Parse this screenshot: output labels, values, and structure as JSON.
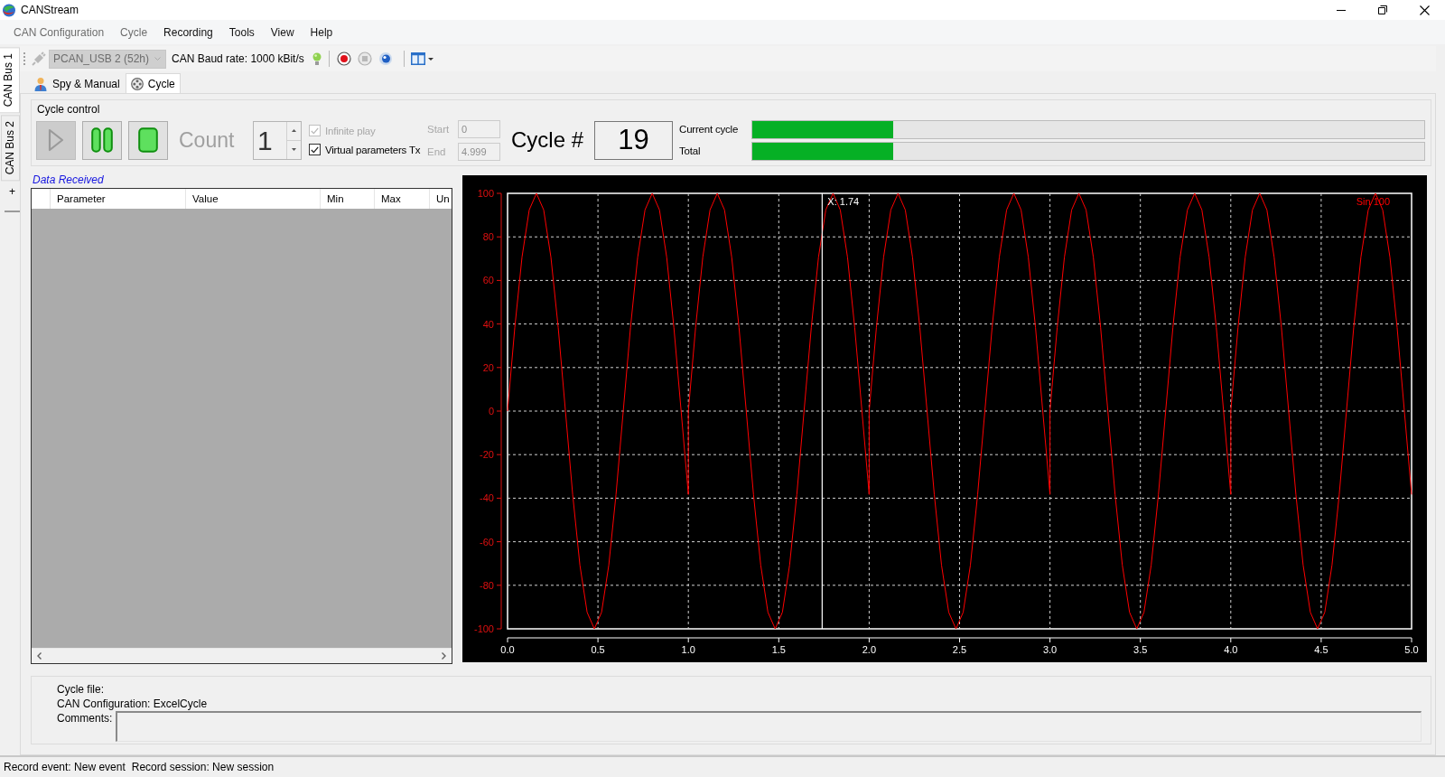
{
  "window": {
    "title": "CANStream"
  },
  "menu": [
    {
      "label": "CAN Configuration",
      "disabled": true
    },
    {
      "label": "Cycle",
      "disabled": true
    },
    {
      "label": "Recording",
      "disabled": false
    },
    {
      "label": "Tools",
      "disabled": false
    },
    {
      "label": "View",
      "disabled": false
    },
    {
      "label": "Help",
      "disabled": false
    }
  ],
  "bus_tabs": [
    {
      "label": "CAN Bus 1",
      "selected": true
    },
    {
      "label": "CAN Bus 2",
      "selected": false
    }
  ],
  "add_bus_tab": "+",
  "toolbar": {
    "device": {
      "value": "PCAN_USB 2 (52h)",
      "disabled": true
    },
    "baud_rate": "CAN Baud rate: 1000 kBit/s"
  },
  "tabs": [
    {
      "label": "Spy & Manual",
      "kind": "user",
      "selected": false
    },
    {
      "label": "Cycle",
      "kind": "reel",
      "selected": true
    }
  ],
  "cycle_control": {
    "title": "Cycle control",
    "transport": [
      {
        "kind": "play",
        "disabled": true
      },
      {
        "kind": "pause",
        "disabled": false
      },
      {
        "kind": "stop",
        "disabled": false
      }
    ],
    "count_label": "Count",
    "count": "1",
    "options": [
      {
        "label": "Infinite play",
        "checked": true,
        "disabled": true
      },
      {
        "label": "Virtual parameters Tx",
        "checked": true,
        "disabled": false
      }
    ],
    "range": [
      {
        "label": "Start",
        "value": "0",
        "disabled": true
      },
      {
        "label": "End",
        "value": "4.999",
        "disabled": true
      }
    ],
    "cycle_label": "Cycle #",
    "cycle_number": "19",
    "progress": [
      {
        "label": "Current cycle",
        "level": 0.21
      },
      {
        "label": "Total",
        "level": 0.21
      }
    ]
  },
  "data_received": {
    "title": "Data Received",
    "columns": [
      "Parameter",
      "Value",
      "Min",
      "Max",
      "Un"
    ]
  },
  "chart": {
    "chart_data": {
      "type": "line",
      "x": [
        0,
        0.04,
        0.08,
        0.12,
        0.16,
        0.2,
        0.24,
        0.28,
        0.32,
        0.36,
        0.4,
        0.44,
        0.48,
        0.52,
        0.56,
        0.6,
        0.64,
        0.68,
        0.72,
        0.76,
        0.8,
        0.84,
        0.88,
        0.92,
        0.96,
        1,
        1,
        1.04,
        1.08,
        1.12,
        1.16,
        1.2,
        1.24,
        1.28,
        1.32,
        1.36,
        1.4,
        1.44,
        1.48,
        1.52,
        1.56,
        1.6,
        1.64,
        1.68,
        1.72,
        1.76,
        1.8,
        1.84,
        1.88,
        1.92,
        1.96,
        2,
        2,
        2.04,
        2.08,
        2.12,
        2.16,
        2.2,
        2.24,
        2.28,
        2.32,
        2.36,
        2.4,
        2.44,
        2.48,
        2.52,
        2.56,
        2.6,
        2.64,
        2.68,
        2.72,
        2.76,
        2.8,
        2.84,
        2.88,
        2.92,
        2.96,
        3,
        3,
        3.04,
        3.08,
        3.12,
        3.16,
        3.2,
        3.24,
        3.28,
        3.32,
        3.36,
        3.4,
        3.44,
        3.48,
        3.52,
        3.56,
        3.6,
        3.64,
        3.68,
        3.72,
        3.76,
        3.8,
        3.84,
        3.88,
        3.92,
        3.96,
        4,
        4,
        4.04,
        4.08,
        4.12,
        4.16,
        4.2,
        4.24,
        4.28,
        4.32,
        4.36,
        4.4,
        4.44,
        4.48,
        4.52,
        4.56,
        4.6,
        4.64,
        4.68,
        4.72,
        4.76,
        4.8,
        4.84,
        4.88,
        4.92,
        4.96,
        5
      ],
      "series": [
        {
          "name": "Sin 100",
          "color": "#ff0000",
          "values": [
            0,
            38.3,
            70.7,
            92.4,
            100,
            92.4,
            70.7,
            38.3,
            0,
            -38.3,
            -70.7,
            -92.4,
            -100,
            -92.4,
            -70.7,
            -38.3,
            0,
            38.3,
            70.7,
            92.4,
            100,
            92.4,
            70.7,
            38.3,
            0,
            -38.3,
            0,
            38.3,
            70.7,
            92.4,
            100,
            92.4,
            70.7,
            38.3,
            0,
            -38.3,
            -70.7,
            -92.4,
            -100,
            -92.4,
            -70.7,
            -38.3,
            0,
            38.3,
            70.7,
            92.4,
            100,
            92.4,
            70.7,
            38.3,
            0,
            -38.3,
            0,
            38.3,
            70.7,
            92.4,
            100,
            92.4,
            70.7,
            38.3,
            0,
            -38.3,
            -70.7,
            -92.4,
            -100,
            -92.4,
            -70.7,
            -38.3,
            0,
            38.3,
            70.7,
            92.4,
            100,
            92.4,
            70.7,
            38.3,
            0,
            -38.3,
            0,
            38.3,
            70.7,
            92.4,
            100,
            92.4,
            70.7,
            38.3,
            0,
            -38.3,
            -70.7,
            -92.4,
            -100,
            -92.4,
            -70.7,
            -38.3,
            0,
            38.3,
            70.7,
            92.4,
            100,
            92.4,
            70.7,
            38.3,
            0,
            -38.3,
            0,
            38.3,
            70.7,
            92.4,
            100,
            92.4,
            70.7,
            38.3,
            0,
            -38.3,
            -70.7,
            -92.4,
            -100,
            -92.4,
            -70.7,
            -38.3,
            0,
            38.3,
            70.7,
            92.4,
            100,
            92.4,
            70.7,
            38.3,
            0,
            -38.3
          ]
        }
      ],
      "xlim": [
        0,
        5
      ],
      "ylim": [
        -100,
        100
      ],
      "xticks": [
        {
          "value": 0,
          "label": "0.0"
        },
        {
          "value": 0.5,
          "label": "0.5"
        },
        {
          "value": 1,
          "label": "1.0"
        },
        {
          "value": 1.5,
          "label": "1.5"
        },
        {
          "value": 2,
          "label": "2.0"
        },
        {
          "value": 2.5,
          "label": "2.5"
        },
        {
          "value": 3,
          "label": "3.0"
        },
        {
          "value": 3.5,
          "label": "3.5"
        },
        {
          "value": 4,
          "label": "4.0"
        },
        {
          "value": 4.5,
          "label": "4.5"
        },
        {
          "value": 5,
          "label": "5.0"
        }
      ],
      "yticks": [
        -100,
        -80,
        -60,
        -40,
        -20,
        0,
        20,
        40,
        60,
        80,
        100
      ],
      "grid": true,
      "ref_lines": [
        {
          "axis": "x",
          "value": 1.74,
          "label": "X: 1.74",
          "color": "#ffffff"
        }
      ]
    }
  },
  "cycle_info": {
    "cycle_file": "Cycle file:",
    "can_configuration": "CAN Configuration: ExcelCycle",
    "comments_label": "Comments:"
  },
  "status_bar": [
    "Record event: New event",
    "Record session: New session"
  ]
}
